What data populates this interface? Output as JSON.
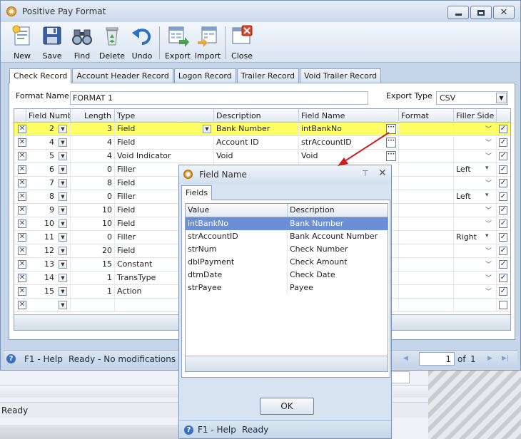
{
  "window": {
    "title": "Positive Pay Format"
  },
  "toolbar": [
    {
      "label": "New",
      "icon": "new-document-icon"
    },
    {
      "label": "Save",
      "icon": "save-disk-icon"
    },
    {
      "label": "Find",
      "icon": "binoculars-icon"
    },
    {
      "label": "Delete",
      "icon": "recycle-bin-icon"
    },
    {
      "label": "Undo",
      "icon": "undo-arrow-icon"
    },
    {
      "label": "Export",
      "icon": "export-icon"
    },
    {
      "label": "Import",
      "icon": "import-icon"
    },
    {
      "label": "Close",
      "icon": "close-window-icon"
    }
  ],
  "tabs": [
    "Check Record",
    "Account Header Record",
    "Logon Record",
    "Trailer Record",
    "Void Trailer Record"
  ],
  "form": {
    "format_name_label": "Format Name",
    "format_name_value": "FORMAT 1",
    "export_type_label": "Export Type",
    "export_type_value": "CSV"
  },
  "grid": {
    "columns": [
      "Field Number",
      "Length",
      "Type",
      "Description",
      "Field Name",
      "Format",
      "Filler Side"
    ],
    "rows": [
      {
        "field_number": "2",
        "length": "3",
        "type": "Field",
        "description": "Bank Number",
        "field_name": "intBankNo",
        "format": "",
        "filler_side": "",
        "checked": true
      },
      {
        "field_number": "4",
        "length": "4",
        "type": "Field",
        "description": "Account ID",
        "field_name": "strAccountID",
        "format": "",
        "filler_side": "",
        "checked": true
      },
      {
        "field_number": "5",
        "length": "4",
        "type": "Void Indicator",
        "description": "Void",
        "field_name": "Void",
        "format": "",
        "filler_side": "",
        "checked": true
      },
      {
        "field_number": "6",
        "length": "0",
        "type": "Filler",
        "description": "",
        "field_name": "",
        "format": "",
        "filler_side": "Left",
        "checked": true
      },
      {
        "field_number": "7",
        "length": "8",
        "type": "Field",
        "description": "",
        "field_name": "",
        "format": "",
        "filler_side": "",
        "checked": true
      },
      {
        "field_number": "8",
        "length": "0",
        "type": "Filler",
        "description": "",
        "field_name": "",
        "format": "",
        "filler_side": "Left",
        "checked": true
      },
      {
        "field_number": "9",
        "length": "10",
        "type": "Field",
        "description": "",
        "field_name": "",
        "format": "",
        "filler_side": "",
        "checked": true
      },
      {
        "field_number": "10",
        "length": "10",
        "type": "Field",
        "description": "",
        "field_name": "",
        "format": "",
        "filler_side": "",
        "checked": true
      },
      {
        "field_number": "11",
        "length": "0",
        "type": "Filler",
        "description": "",
        "field_name": "",
        "format": "",
        "filler_side": "Right",
        "checked": true
      },
      {
        "field_number": "12",
        "length": "20",
        "type": "Field",
        "description": "",
        "field_name": "",
        "format": "",
        "filler_side": "",
        "checked": true
      },
      {
        "field_number": "13",
        "length": "15",
        "type": "Constant",
        "description": "",
        "field_name": "",
        "format": "",
        "filler_side": "",
        "checked": true
      },
      {
        "field_number": "14",
        "length": "1",
        "type": "TransType",
        "description": "",
        "field_name": "",
        "format": "",
        "filler_side": "",
        "checked": true
      },
      {
        "field_number": "15",
        "length": "1",
        "type": "Action",
        "description": "",
        "field_name": "",
        "format": "",
        "filler_side": "",
        "checked": true
      },
      {
        "field_number": "",
        "length": "",
        "type": "",
        "description": "",
        "field_name": "",
        "format": "",
        "filler_side": "",
        "checked": false
      }
    ]
  },
  "status": {
    "help": "F1 - Help",
    "message": "Ready - No modifications ma",
    "page": "1",
    "of_label": "of",
    "total": "1"
  },
  "dialog": {
    "title": "Field Name",
    "tab": "Fields",
    "columns": [
      "Value",
      "Description"
    ],
    "rows": [
      {
        "value": "intBankNo",
        "description": "Bank Number"
      },
      {
        "value": "strAccountID",
        "description": "Bank Account Number"
      },
      {
        "value": "strNum",
        "description": "Check Number"
      },
      {
        "value": "dblPayment",
        "description": "Check Amount"
      },
      {
        "value": "dtmDate",
        "description": "Check Date"
      },
      {
        "value": "strPayee",
        "description": "Payee"
      }
    ],
    "ok_label": "OK",
    "help": "F1 - Help",
    "status": "Ready"
  },
  "background_status": "Ready",
  "colors": {
    "selected_row": "#ffff66",
    "dialog_selection": "#6b8fd6",
    "annotation_arrow": "#cc1f1f"
  }
}
